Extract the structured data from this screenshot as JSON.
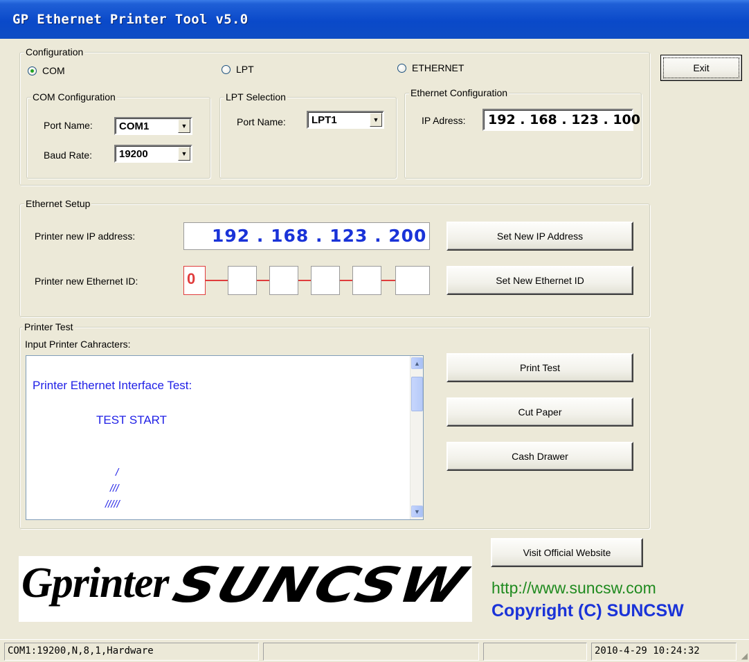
{
  "window": {
    "title": "GP Ethernet Printer Tool v5.0"
  },
  "configuration": {
    "legend": "Configuration",
    "radios": {
      "com": "COM",
      "lpt": "LPT",
      "ethernet": "ETHERNET",
      "selected": "COM"
    },
    "com": {
      "legend": "COM Configuration",
      "port_label": "Port Name:",
      "port_value": "COM1",
      "baud_label": "Baud Rate:",
      "baud_value": "19200"
    },
    "lpt": {
      "legend": "LPT Selection",
      "port_label": "Port Name:",
      "port_value": "LPT1"
    },
    "ethernet": {
      "legend": "Ethernet Configuration",
      "ip_label": "IP Adress:",
      "ip_value": "192 . 168 . 123 . 100"
    }
  },
  "exit_button": "Exit",
  "ethernet_setup": {
    "legend": "Ethernet Setup",
    "new_ip_label": "Printer new IP address:",
    "new_ip_value": "192 . 168 . 123 . 200",
    "set_ip_button": "Set New IP Address",
    "new_id_label": "Printer new Ethernet ID:",
    "id_fields": [
      "0",
      "",
      "",
      "",
      "",
      ""
    ],
    "set_id_button": "Set New Ethernet ID"
  },
  "printer_test": {
    "legend": "Printer Test",
    "input_label": "Input Printer Cahracters:",
    "text_lines": [
      "Printer Ethernet Interface Test:",
      "TEST  START",
      "/",
      "///",
      "/////"
    ],
    "print_test_button": "Print Test",
    "cut_paper_button": "Cut Paper",
    "cash_drawer_button": "Cash Drawer"
  },
  "footer": {
    "visit_button": "Visit Official Website",
    "logo_left": "Gprinter",
    "logo_right": "SUNCSW",
    "url": "http://www.suncsw.com",
    "copyright": "Copyright (C) SUNCSW"
  },
  "statusbar": {
    "port_status": "COM1:19200,N,8,1,Hardware",
    "panel2": "",
    "panel3": "",
    "datetime": "2010-4-29 10:24:32"
  },
  "colors": {
    "titlebar": "#0a49c9",
    "ip_blue": "#1a33d8",
    "id_red": "#e03c3c",
    "test_text_blue": "#1e1ee6",
    "url_green": "#1f8a1f"
  }
}
